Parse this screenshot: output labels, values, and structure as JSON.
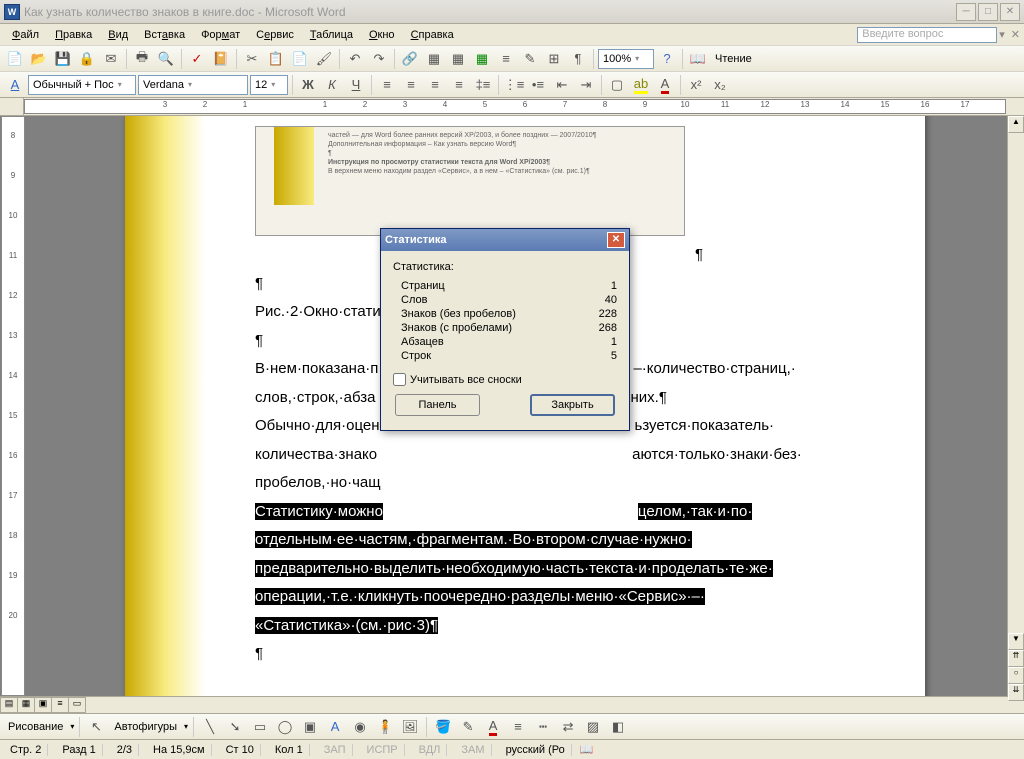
{
  "title": "Как узнать количество знаков в книге.doc - Microsoft Word",
  "menu": {
    "file": "Файл",
    "edit": "Правка",
    "view": "Вид",
    "insert": "Вставка",
    "format": "Формат",
    "tools": "Сервис",
    "table": "Таблица",
    "window": "Окно",
    "help": "Справка"
  },
  "ask_question": "Введите вопрос",
  "toolbar": {
    "zoom": "100%",
    "reading": "Чтение"
  },
  "format_bar": {
    "style": "Обычный + Пос",
    "font": "Verdana",
    "size": "12"
  },
  "ruler_h": [
    "3",
    "2",
    "1",
    "",
    "1",
    "2",
    "3",
    "4",
    "5",
    "6",
    "7",
    "8",
    "9",
    "10",
    "11",
    "12",
    "13",
    "14",
    "15",
    "16",
    "17"
  ],
  "ruler_v": [
    "8",
    "9",
    "10",
    "11",
    "12",
    "13",
    "14",
    "15",
    "16",
    "17",
    "18",
    "19",
    "20"
  ],
  "embedded": {
    "l1": "частей — для Word более ранних версий XP/2003, и более поздних — 2007/2010¶",
    "l2": "Дополнительная информация – Как узнать версию Word¶",
    "l3": "¶",
    "l4": "Инструкция по просмотру статистики текста для Word XP/2003¶",
    "l5": "В верхнем меню находим раздел «Сервис», а в нем – «Статистика» (см. рис.1)¶"
  },
  "doc": {
    "p_pilcrow": "¶",
    "p_after_embed": "¶",
    "caption": "Рис.·2·Окно·стати",
    "p1a": "В·нем·показана·п",
    "p1b": "–·количество·страниц,·",
    "p2a": "слов,·строк,·абза",
    "p2b": "них.¶",
    "p3a": "Обычно·для·оцен",
    "p3b": "ьзуется·показатель·",
    "p4a": "количества·знако",
    "p4b": "аются·только·знаки·без·",
    "p5a": "пробелов,·но·чащ",
    "sel1": "Статистику·можно",
    "sel1b": "целом,·так·и·по·",
    "sel2": "отдельным·ее·частям,·фрагментам.·Во·втором·случае·нужно·",
    "sel3": "предварительно·выделить·необходимую·часть·текста·и·проделать·те·же·",
    "sel4": "операции,·т.е.·кликнуть·поочередно·разделы·меню·«Сервис»·–·",
    "sel5": "«Статистика»·(см.·рис·3)¶"
  },
  "dialog": {
    "title": "Статистика",
    "heading": "Статистика:",
    "rows": [
      {
        "label": "Страниц",
        "value": "1"
      },
      {
        "label": "Слов",
        "value": "40"
      },
      {
        "label": "Знаков (без пробелов)",
        "value": "228"
      },
      {
        "label": "Знаков (с пробелами)",
        "value": "268"
      },
      {
        "label": "Абзацев",
        "value": "1"
      },
      {
        "label": "Строк",
        "value": "5"
      }
    ],
    "footnotes": "Учитывать все сноски",
    "panel": "Панель",
    "close": "Закрыть"
  },
  "draw": {
    "menu": "Рисование",
    "autoshapes": "Автофигуры"
  },
  "status": {
    "page": "Стр. 2",
    "section": "Разд 1",
    "pages": "2/3",
    "at": "На 15,9см",
    "line": "Ст 10",
    "col": "Кол 1",
    "rec": "ЗАП",
    "trk": "ИСПР",
    "ext": "ВДЛ",
    "ovr": "ЗАМ",
    "lang": "русский (Ро"
  }
}
